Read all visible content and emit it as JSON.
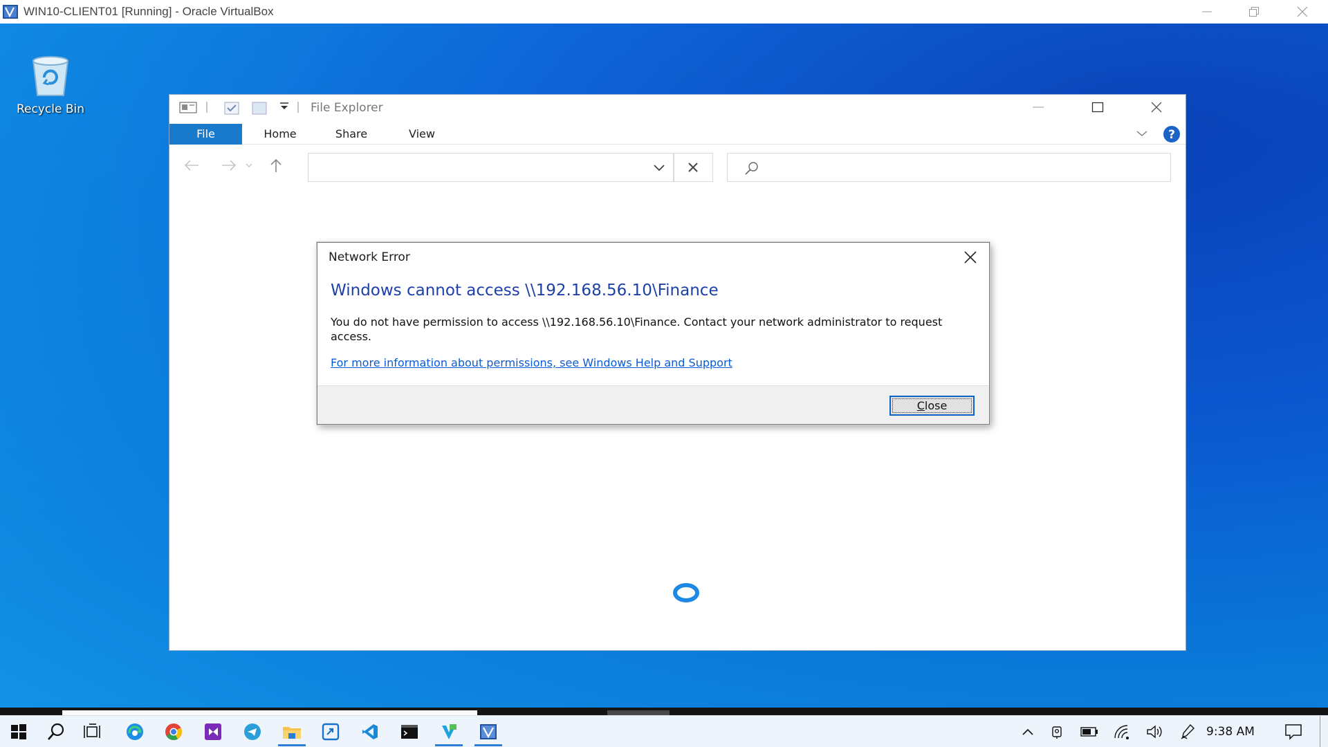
{
  "host_window": {
    "title": "WIN10-CLIENT01 [Running] - Oracle VirtualBox"
  },
  "desktop": {
    "recycle_bin_label": "Recycle Bin"
  },
  "explorer": {
    "title": "File Explorer",
    "tabs": [
      {
        "label": "File"
      },
      {
        "label": "Home"
      },
      {
        "label": "Share"
      },
      {
        "label": "View"
      }
    ],
    "address_value": "",
    "search_value": ""
  },
  "dialog": {
    "title": "Network Error",
    "heading": "Windows cannot access \\\\192.168.56.10\\Finance",
    "body": "You do not have permission to access \\\\192.168.56.10\\Finance. Contact your network administrator to request access.",
    "link": "For more information about permissions, see Windows Help and Support",
    "close_button": "Close"
  },
  "taskbar": {
    "apps": [
      "start-icon",
      "search-icon",
      "task-view-icon",
      "edge-icon",
      "chrome-icon",
      "visual-studio-icon",
      "telegram-icon",
      "file-explorer-icon",
      "remote-desktop-icon",
      "vscode-icon",
      "terminal-icon",
      "app-icon",
      "virtualbox-icon"
    ],
    "active_apps": [
      "file-explorer-icon",
      "app-icon",
      "virtualbox-icon"
    ],
    "clock": "9:38 AM"
  },
  "colors": {
    "accent": "#1979ca",
    "dialog_heading": "#1d3fa8",
    "link": "#0a5bd6"
  }
}
